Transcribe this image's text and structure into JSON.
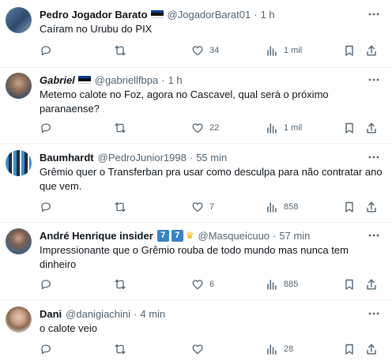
{
  "tweets": [
    {
      "name": "Pedro Jogador Barato",
      "handle": "@JogadorBarat01",
      "time": "1 h",
      "text": "Caíram no Urubu do PIX",
      "replies": "",
      "retweets": "",
      "likes": "34",
      "views": "1 mil"
    },
    {
      "name": "Gabriel",
      "handle": "@gabriellfbpa",
      "time": "1 h",
      "text": "Metemo calote no Foz, agora no Cascavel, qual será o próximo paranaense?",
      "replies": "",
      "retweets": "",
      "likes": "22",
      "views": "1 mil"
    },
    {
      "name": "Baumhardt",
      "handle": "@PedroJunior1998",
      "time": "55 min",
      "text": "Grêmio quer o Transferban pra usar como desculpa para não contratar ano que vem.",
      "replies": "",
      "retweets": "",
      "likes": "7",
      "views": "858"
    },
    {
      "name": "André Henrique insider",
      "handle": "@Masqueicuuo",
      "time": "57 min",
      "badge1": "7",
      "badge2": "7",
      "text": "Impressionante que o Grêmio rouba de todo mundo mas nunca tem dinheiro",
      "replies": "",
      "retweets": "",
      "likes": "6",
      "views": "885"
    },
    {
      "name": "Dani",
      "handle": "@danigiachini",
      "time": "4 min",
      "text": "o calote veio",
      "replies": "",
      "retweets": "",
      "likes": "",
      "views": "28"
    }
  ],
  "icons": {
    "reply": "reply-icon",
    "retweet": "retweet-icon",
    "like": "heart-icon",
    "views": "views-icon",
    "bookmark": "bookmark-icon",
    "share": "share-icon",
    "more": "more-icon"
  },
  "colors": {
    "text": "#0f1419",
    "muted": "#536471",
    "divider": "#eff3f4"
  }
}
